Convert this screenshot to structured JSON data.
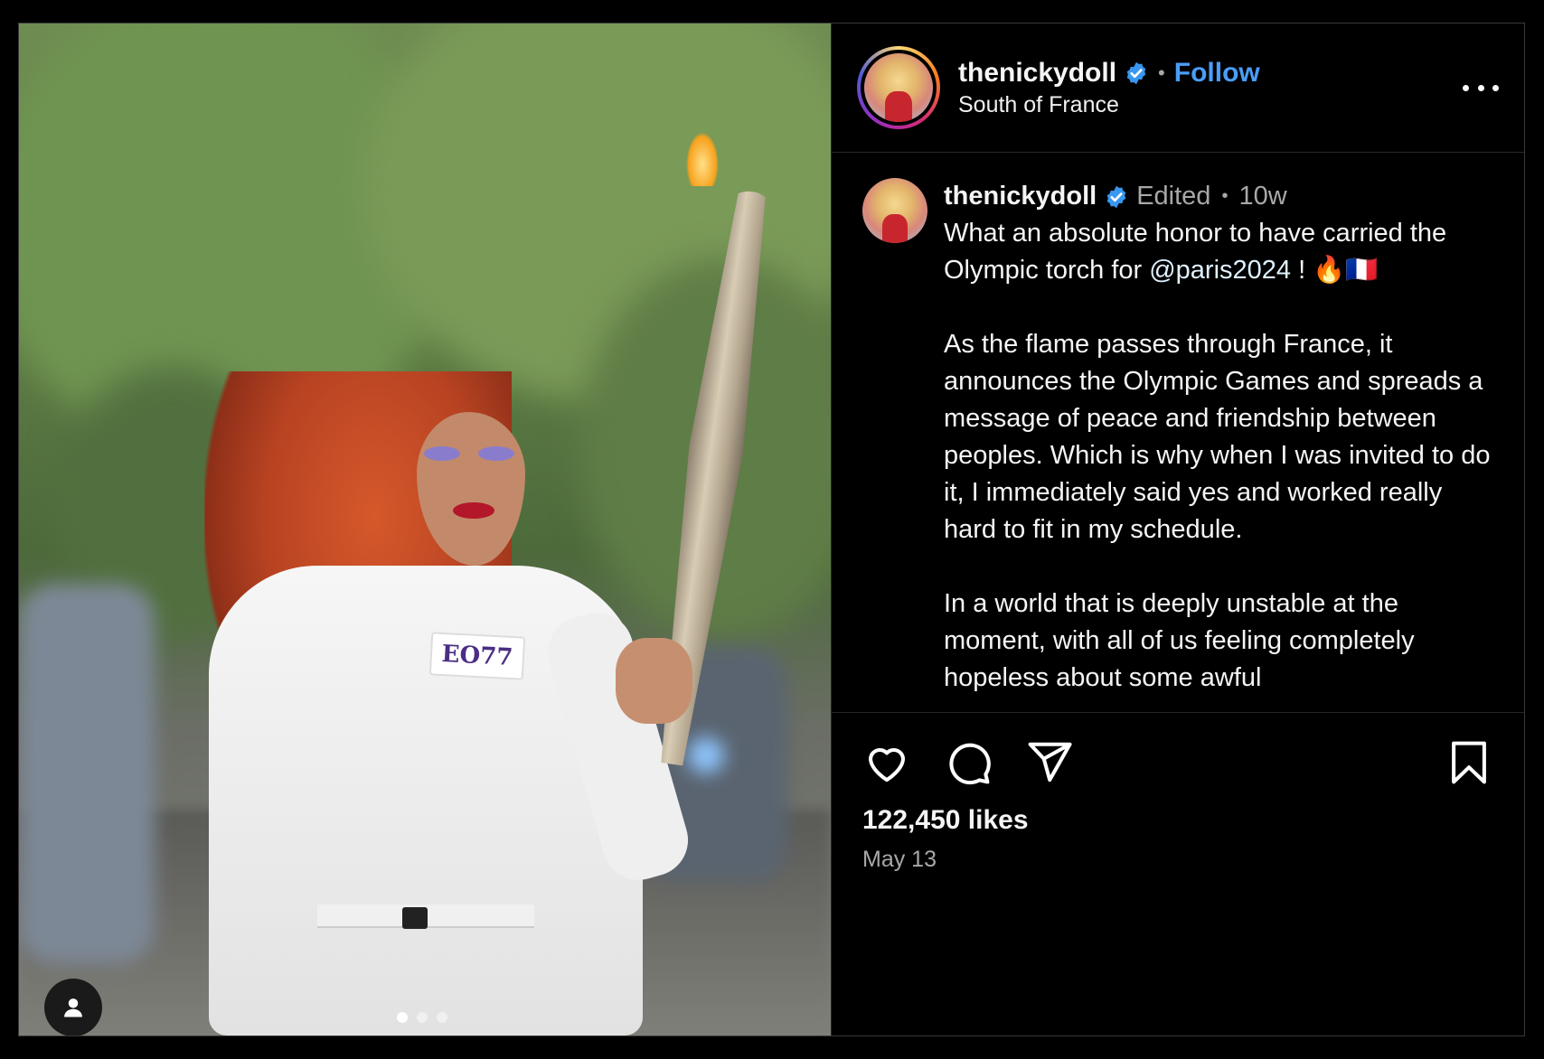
{
  "post": {
    "author": {
      "username": "thenickydoll",
      "verified": true,
      "location": "South of France",
      "follow_label": "Follow",
      "separator": "•"
    },
    "media": {
      "badge_text": "EO77",
      "carousel": {
        "count": 3,
        "active_index": 0
      }
    },
    "caption": {
      "username": "thenickydoll",
      "edited_label": "Edited",
      "separator": "•",
      "age": "10w",
      "line1_pre": "What an absolute honor to have carried the Olympic torch for ",
      "mention": "@paris2024",
      "line1_post": " ! 🔥🇫🇷",
      "paragraph2": "As the flame passes through France, it announces the Olympic Games and spreads a message of peace and friendship between peoples. Which is why when I was invited to do it, I immediately said yes and worked really hard to fit in my schedule.",
      "paragraph3": "In a world that is deeply unstable at the moment, with all of us feeling completely hopeless about some awful"
    },
    "engagement": {
      "likes": "122,450 likes",
      "date": "May 13"
    },
    "icons": {
      "like": "heart-icon",
      "comment": "comment-icon",
      "share": "share-icon",
      "save": "bookmark-icon",
      "more": "more-horizontal-icon",
      "user_tag": "person-icon"
    },
    "colors": {
      "background": "#000000",
      "link_blue": "#4a9df8",
      "verified_blue": "#3897f0",
      "secondary_text": "#a8a8a8"
    }
  }
}
